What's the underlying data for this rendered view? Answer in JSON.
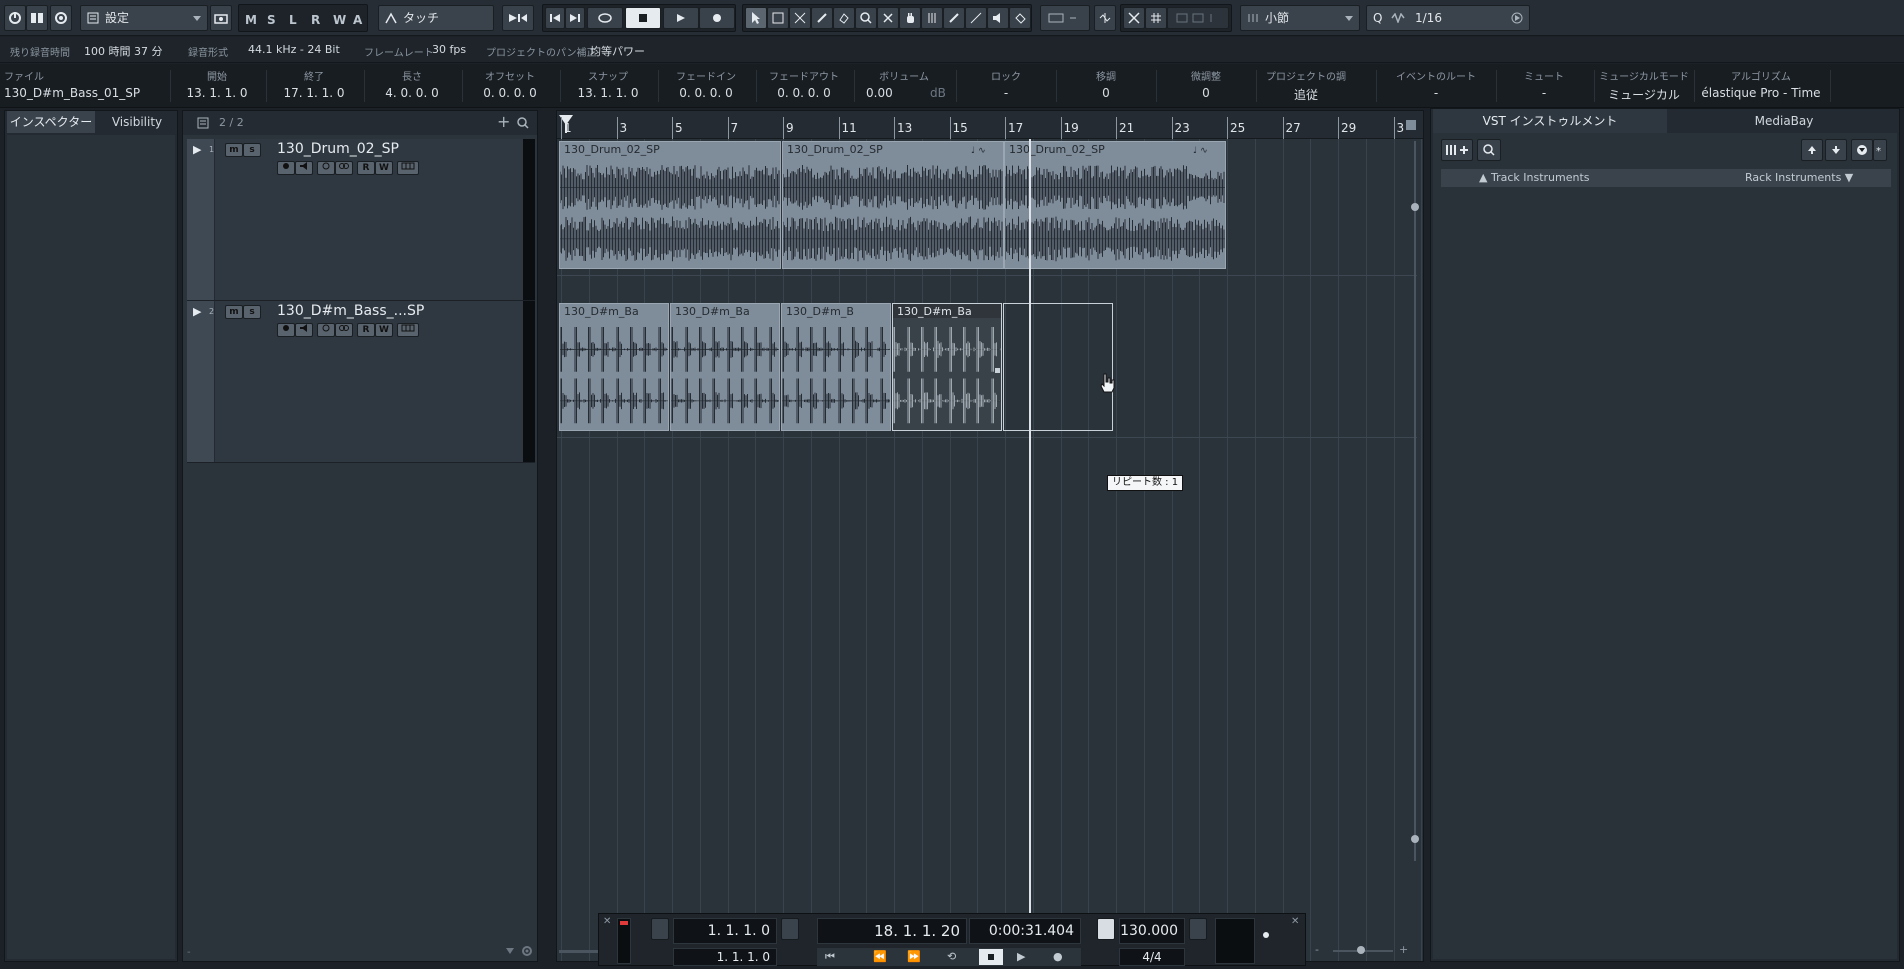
{
  "toolbar": {
    "settings_label": "設定",
    "msl": [
      "M",
      "S",
      "L",
      "R",
      "W",
      "A"
    ],
    "automation_mode": "タッチ",
    "grid_type": "小節",
    "quantize_label": "Q",
    "quantize_value": "1/16"
  },
  "status": {
    "rec_time_label": "残り録音時間",
    "rec_time_value": "100 時間 37 分",
    "rec_format_label": "録音形式",
    "rec_format_value": "44.1 kHz - 24 Bit",
    "frame_rate_label": "フレームレート",
    "frame_rate_value": "30 fps",
    "pan_law_label": "プロジェクトのパン補正",
    "pan_law_value": "均等パワー"
  },
  "infoline": {
    "columns": [
      {
        "header": "ファイル",
        "value": "130_D#m_Bass_01_SP"
      },
      {
        "header": "開始",
        "value": "13.  1.  1.    0"
      },
      {
        "header": "終了",
        "value": "17.  1.  1.    0"
      },
      {
        "header": "長さ",
        "value": "4.  0.  0.    0"
      },
      {
        "header": "オフセット",
        "value": "0.  0.  0.    0"
      },
      {
        "header": "スナップ",
        "value": "13.  1.  1.    0"
      },
      {
        "header": "フェードイン",
        "value": "0.  0.  0.    0"
      },
      {
        "header": "フェードアウト",
        "value": "0.  0.  0.    0"
      },
      {
        "header": "ボリューム",
        "value": "0.00",
        "unit": "dB"
      },
      {
        "header": "ロック",
        "value": "-"
      },
      {
        "header": "移調",
        "value": "0"
      },
      {
        "header": "微調整",
        "value": "0"
      },
      {
        "header": "プロジェクトの調",
        "value": "追従"
      },
      {
        "header": "イベントのルート",
        "value": "-"
      },
      {
        "header": "ミュート",
        "value": "-"
      },
      {
        "header": "ミュージカルモード",
        "value": "ミュージカル"
      },
      {
        "header": "アルゴリズム",
        "value": "élastique Pro - Time"
      }
    ]
  },
  "inspector": {
    "tab_inspector": "インスペクター",
    "tab_visibility": "Visibility"
  },
  "tracklist": {
    "count": "2 / 2",
    "tracks": [
      {
        "number": "1",
        "name": "130_Drum_02_SP"
      },
      {
        "number": "2",
        "name": "130_D#m_Bass_...SP"
      }
    ],
    "btn_m": "m",
    "btn_s": "s",
    "btn_r": "R",
    "btn_w": "W"
  },
  "ruler": {
    "bars": [
      "1",
      "3",
      "5",
      "7",
      "9",
      "11",
      "13",
      "15",
      "17",
      "19",
      "21",
      "23",
      "25",
      "27",
      "29",
      "3"
    ]
  },
  "events": {
    "drum": [
      "130_Drum_02_SP",
      "130_Drum_02_SP",
      "130_Drum_02_SP"
    ],
    "bass": [
      "130_D#m_Ba",
      "130_D#m_Ba",
      "130_D#m_B",
      "130_D#m_Ba"
    ]
  },
  "tooltip": "リピート数 : 1",
  "rightzone": {
    "tab_vst": "VST インストゥルメント",
    "tab_mediabay": "MediaBay",
    "track_instruments": "Track Instruments",
    "rack_instruments": "Rack Instruments"
  },
  "transport": {
    "left_locator": "1.  1.  1.    0",
    "right_locator": "1.  1.  1.    0",
    "position_bars": "18.  1.  1.  20",
    "position_time": "0:00:31.404",
    "tempo": "130.000",
    "signature": "4/4"
  },
  "colors": {
    "event_fill": "#7f8c9a",
    "waveform": "#1d232a",
    "selected_event_bg": "#2f353b"
  }
}
